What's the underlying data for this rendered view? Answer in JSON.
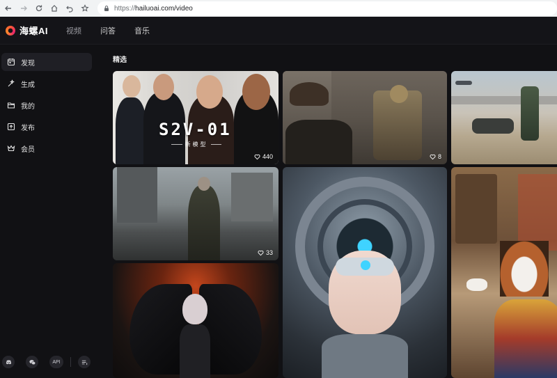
{
  "browser": {
    "url_scheme": "https://",
    "url_rest": "hailuoai.com/video"
  },
  "header": {
    "logo_text": "海螺AI",
    "nav": [
      {
        "label": "视频"
      },
      {
        "label": "问答"
      },
      {
        "label": "音乐"
      }
    ]
  },
  "sidebar": {
    "items": [
      {
        "label": "发现",
        "icon": "calendar-icon",
        "active": true
      },
      {
        "label": "生成",
        "icon": "sparkle-wand-icon",
        "active": false
      },
      {
        "label": "我的",
        "icon": "folder-icon",
        "active": false
      },
      {
        "label": "发布",
        "icon": "publish-icon",
        "active": false
      },
      {
        "label": "会员",
        "icon": "crown-icon",
        "active": false
      }
    ],
    "bottom": {
      "discord_icon": "discord-icon",
      "wechat_icon": "wechat-icon",
      "api_label": "API",
      "menu_icon": "list-menu-icon"
    }
  },
  "main": {
    "section_title": "精选",
    "cards": [
      {
        "title": "S2V-01",
        "subtitle": "新模型",
        "likes": "440"
      },
      {
        "likes": "8"
      },
      {
        "likes": ""
      },
      {
        "likes": "33"
      },
      {
        "likes": ""
      },
      {
        "likes": ""
      },
      {
        "likes": ""
      }
    ]
  },
  "colors": {
    "background": "#111114",
    "header": "#141418",
    "active_item": "#1f1f25",
    "brand_gradient": [
      "#ff5a36",
      "#e8236b",
      "#ff8a2a"
    ]
  }
}
